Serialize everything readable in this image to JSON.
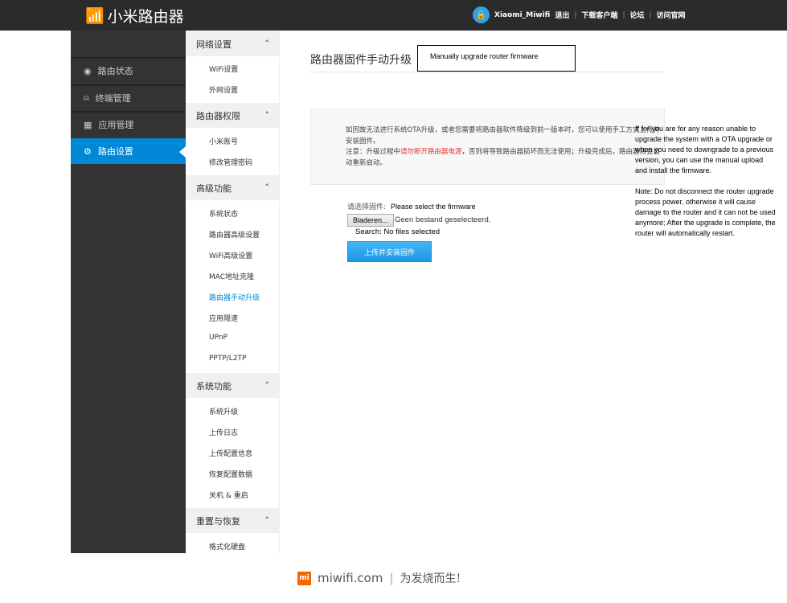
{
  "header": {
    "brand": "小米路由器",
    "username": "Xiaomi_Miwifi",
    "links": [
      "退出",
      "下载客户端",
      "论坛",
      "访问官网"
    ]
  },
  "nav": [
    {
      "label": "路由状态",
      "icon": "gauge-icon"
    },
    {
      "label": "终端管理",
      "icon": "user-icon"
    },
    {
      "label": "应用管理",
      "icon": "grid-icon"
    },
    {
      "label": "路由设置",
      "icon": "gear-icon",
      "active": true
    }
  ],
  "submenu": {
    "sections": [
      {
        "title": "网络设置",
        "items": [
          "WiFi设置",
          "外网设置"
        ]
      },
      {
        "title": "路由器权限",
        "items": [
          "小米账号",
          "修改管理密码"
        ]
      },
      {
        "title": "高级功能",
        "items": [
          "系统状态",
          "路由器高级设置",
          "WiFi高级设置",
          "MAC地址克隆",
          "路由器手动升级",
          "应用限速",
          "UPnP",
          "PPTP/L2TP"
        ]
      },
      {
        "title": "系统功能",
        "items": [
          "系统升级",
          "上传日志",
          "上传配置信息",
          "恢复配置数据",
          "关机 & 重启"
        ]
      },
      {
        "title": "重置与恢复",
        "items": [
          "格式化硬盘"
        ]
      }
    ],
    "current": "路由器手动升级"
  },
  "main": {
    "title": "路由器固件手动升级",
    "title_translation": "Manually upgrade router firmware",
    "notice_line1": "如因故无法进行系统OTA升级，或者您需要将路由器软件降级到前一版本时，您可以使用手工方式上传并安装固件。",
    "notice_prefix": "注意：升级过程中",
    "notice_warning": "请勿断开路由器电源",
    "notice_suffix": "，否则将导致路由器损坏而无法使用；升级完成后，路由器将会自动重新启动。",
    "translation_p1": "If for you are for any reason unable to upgrade the system with a OTA upgrade or when you need to downgrade to a previous version, you can use the manual upload and install the firmware.",
    "translation_p2": "Note: Do not disconnect the router upgrade process power, otherwise it will cause damage to the router and it can not be used anymore; After the upgrade is complete, the router will automatically restart.",
    "select_label": "请选择固件:",
    "select_translation": "Please select the firmware",
    "browse_button": "Bladeren...",
    "no_file": "Geen bestand geselecteerd.",
    "search_translation": "Search: No files selected",
    "upload_button": "上传并安装固件"
  },
  "footer": {
    "logo": "mi",
    "domain": "miwifi.com",
    "slogan": "为发烧而生!"
  }
}
